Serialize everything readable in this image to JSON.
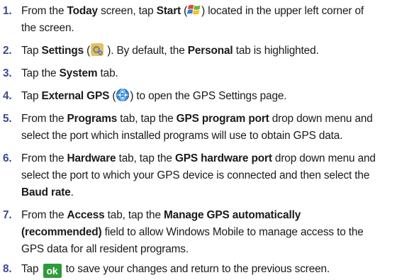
{
  "steps": [
    {
      "num": "1.",
      "parts": {
        "a": "From the ",
        "b": "Today",
        "c": " screen, tap ",
        "d": "Start",
        "e": " (",
        "f": ") located in the upper left corner of",
        "g": "the screen."
      },
      "icon": "windows-start-icon"
    },
    {
      "num": "2.",
      "parts": {
        "a": "Tap ",
        "b": "Settings",
        "c": " (",
        "d": " ). By default, the ",
        "e": "Personal",
        "f": " tab is highlighted."
      },
      "icon": "settings-icon"
    },
    {
      "num": "3.",
      "parts": {
        "a": "Tap the ",
        "b": "System",
        "c": " tab."
      }
    },
    {
      "num": "4.",
      "parts": {
        "a": "Tap ",
        "b": "External GPS",
        "c": " (",
        "d": ") to open the GPS Settings page."
      },
      "icon": "external-gps-icon"
    },
    {
      "num": "5.",
      "parts": {
        "a": "From the ",
        "b": "Programs",
        "c": " tab, tap the ",
        "d": "GPS program port",
        "e": " drop down menu and",
        "f": "select the port which installed programs will use to obtain GPS data."
      }
    },
    {
      "num": "6.",
      "parts": {
        "a": "From the ",
        "b": "Hardware",
        "c": " tab, tap the ",
        "d": "GPS hardware port",
        "e": " drop down menu and",
        "f": "select the port to which your GPS device is connected and then select the",
        "g": "Baud rate",
        "h": "."
      }
    },
    {
      "num": "7.",
      "parts": {
        "a": "From the ",
        "b": "Access",
        "c": " tab, tap the ",
        "d": "Manage GPS automatically",
        "e": "(recommended)",
        "f": " field to allow Windows Mobile to manage access to the",
        "g": "GPS data for all resident programs."
      }
    },
    {
      "num": "8.",
      "parts": {
        "a": "Tap ",
        "ok": "ok",
        "b": " to save your changes and return to the previous screen."
      },
      "icon": "ok-button-icon"
    }
  ],
  "colors": {
    "number": "#3b4a8f",
    "ok_button": "#2e9b3a",
    "text": "#1a1a1a"
  }
}
